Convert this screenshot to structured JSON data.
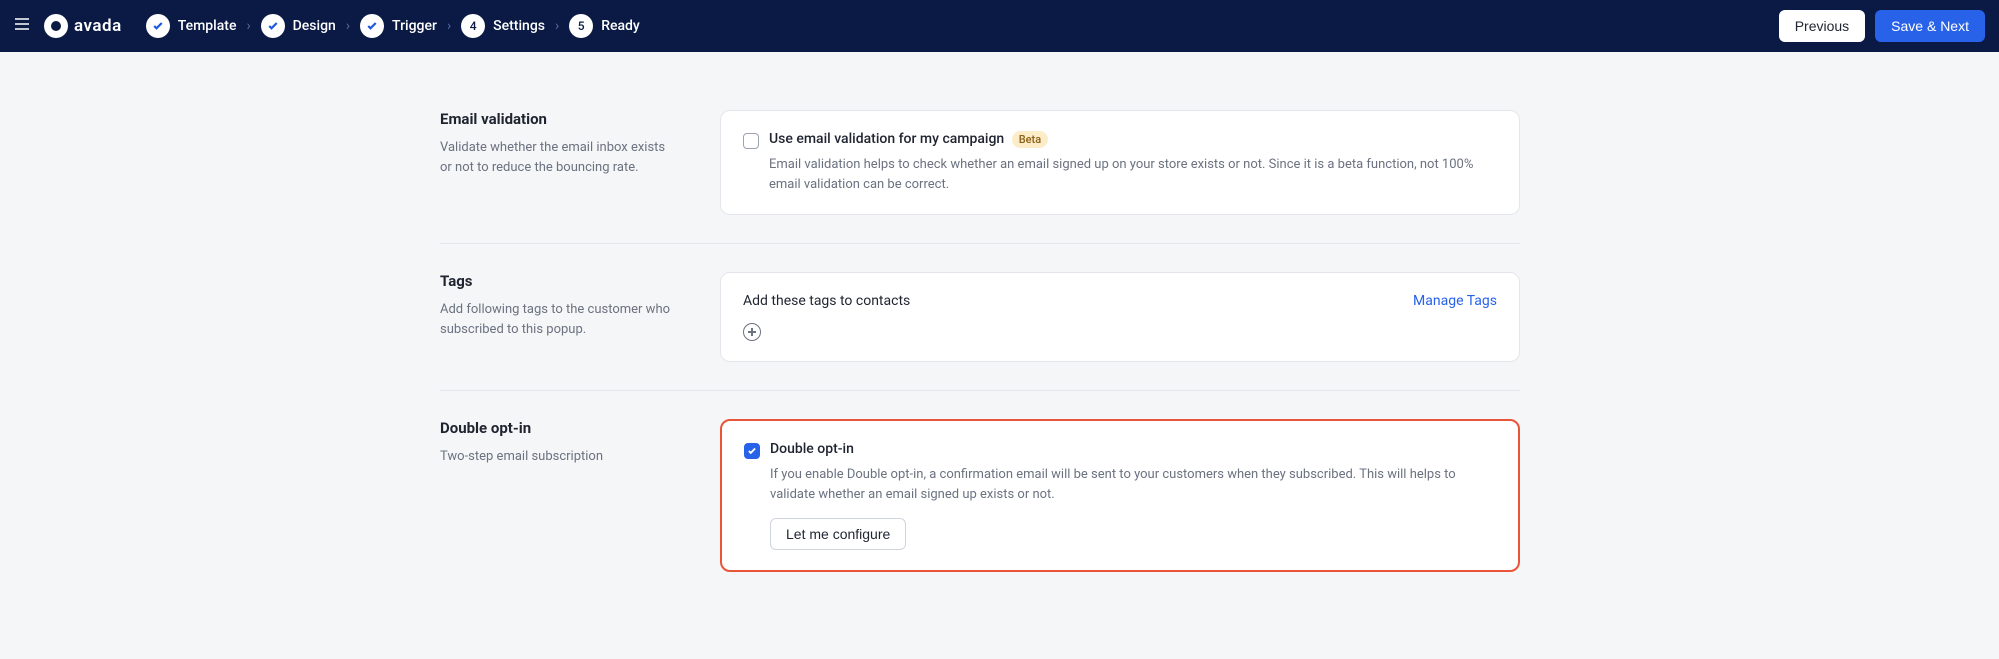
{
  "brand": {
    "name": "avada"
  },
  "steps": [
    {
      "label": "Template",
      "state": "done"
    },
    {
      "label": "Design",
      "state": "done"
    },
    {
      "label": "Trigger",
      "state": "done"
    },
    {
      "label": "Settings",
      "state": "number",
      "num": "4"
    },
    {
      "label": "Ready",
      "state": "number",
      "num": "5"
    }
  ],
  "buttons": {
    "previous": "Previous",
    "save_next": "Save & Next"
  },
  "sections": {
    "email_validation": {
      "title": "Email validation",
      "desc": "Validate whether the email inbox exists or not to reduce the bouncing rate.",
      "checkbox_label": "Use email validation for my campaign",
      "badge": "Beta",
      "sub": "Email validation helps to check whether an email signed up on your store exists or not. Since it is a beta function, not 100% email validation can be correct."
    },
    "tags": {
      "title": "Tags",
      "desc": "Add following tags to the customer who subscribed to this popup.",
      "card_title": "Add these tags to contacts",
      "manage": "Manage Tags"
    },
    "double_optin": {
      "title": "Double opt-in",
      "desc": "Two-step email subscription",
      "checkbox_label": "Double opt-in",
      "sub": "If you enable Double opt-in, a confirmation email will be sent to your customers when they subscribed. This will helps to validate whether an email signed up exists or not.",
      "configure": "Let me configure"
    }
  }
}
